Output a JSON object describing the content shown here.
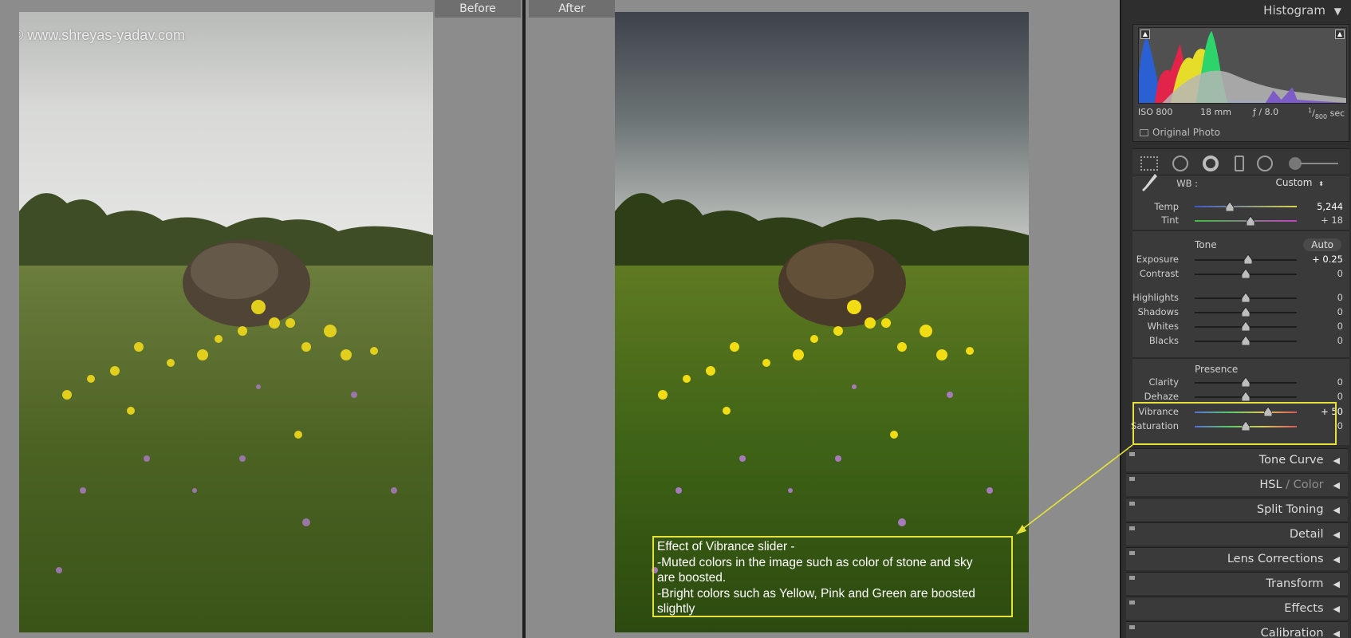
{
  "compare": {
    "before_label": "Before",
    "after_label": "After",
    "watermark": "© www.shreyas-yadav.com",
    "annotation_lines": [
      "Effect of Vibrance slider -",
      "-Muted colors in the image such as color of stone and sky",
      "are boosted.",
      "-Bright colors such as Yellow, Pink and Green are boosted",
      "slightly"
    ]
  },
  "panel": {
    "histogram": {
      "title": "Histogram",
      "iso": "ISO 800",
      "focal": "18 mm",
      "aperture": "ƒ / 8.0",
      "shutter_num": "1",
      "shutter_den": "800",
      "shutter_unit": "sec",
      "original_photo_label": "Original Photo"
    },
    "wb": {
      "label": "WB :",
      "value": "Custom",
      "temp_label": "Temp",
      "temp_value": "5,244",
      "temp_pos": 0.34,
      "tint_label": "Tint",
      "tint_value": "+ 18",
      "tint_pos": 0.55
    },
    "tone": {
      "title": "Tone",
      "auto_label": "Auto",
      "rows": [
        {
          "label": "Exposure",
          "value": "+ 0.25",
          "pos": 0.52
        },
        {
          "label": "Contrast",
          "value": "0",
          "pos": 0.5
        },
        {
          "label": "Highlights",
          "value": "0",
          "pos": 0.5
        },
        {
          "label": "Shadows",
          "value": "0",
          "pos": 0.5
        },
        {
          "label": "Whites",
          "value": "0",
          "pos": 0.5
        },
        {
          "label": "Blacks",
          "value": "0",
          "pos": 0.5
        }
      ]
    },
    "presence": {
      "title": "Presence",
      "rows": [
        {
          "label": "Clarity",
          "value": "0",
          "pos": 0.5
        },
        {
          "label": "Dehaze",
          "value": "0",
          "pos": 0.5
        },
        {
          "label": "Vibrance",
          "value": "+ 50",
          "pos": 0.72
        },
        {
          "label": "Saturation",
          "value": "0",
          "pos": 0.5
        }
      ]
    },
    "sections": [
      {
        "label": "Tone Curve"
      },
      {
        "label": "HSL",
        "label2": "Color"
      },
      {
        "label": "Split Toning"
      },
      {
        "label": "Detail"
      },
      {
        "label": "Lens Corrections"
      },
      {
        "label": "Transform"
      },
      {
        "label": "Effects"
      },
      {
        "label": "Calibration"
      }
    ]
  },
  "colors": {
    "highlight": "#e6e23a",
    "panel_bg": "#3a3a3a"
  }
}
